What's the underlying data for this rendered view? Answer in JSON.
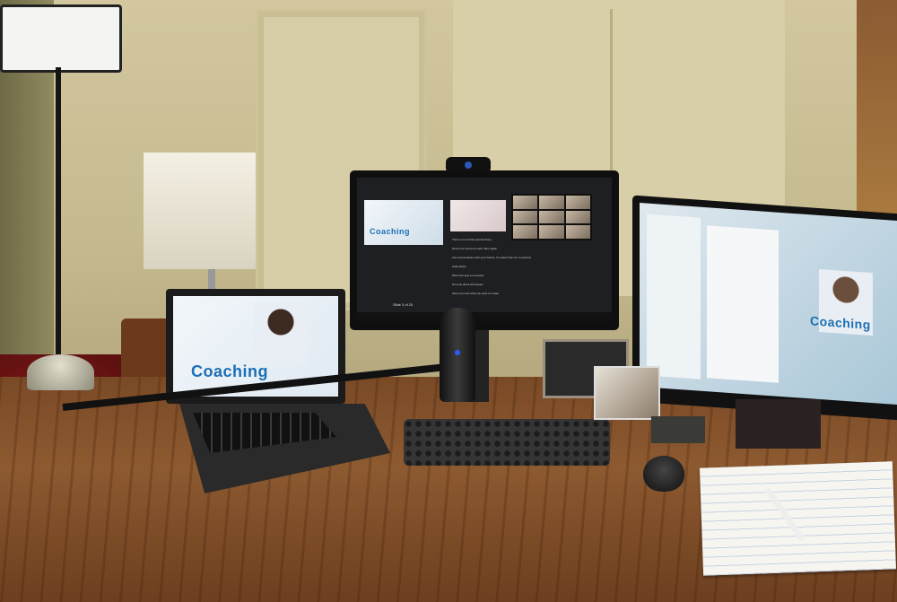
{
  "scene": {
    "description_colors": {
      "wall": "#c8bd92",
      "desk": "#7f4e28",
      "accent_blue": "#1c6fb4"
    }
  },
  "laptop": {
    "slide_title": "Coaching"
  },
  "right_monitor": {
    "slide_title": "Coaching"
  },
  "center_monitor": {
    "slide_title": "Coaching",
    "notes": [
      "There is more than just discovery",
      "How to be human to each other again",
      "Use conversations with your friends, it's easier than for co-workers",
      "Authenticity",
      "More than just a co-worker",
      "Not only about techniques",
      "About you and what you want to create"
    ],
    "slide_counter": "Slide 3 of 20"
  }
}
